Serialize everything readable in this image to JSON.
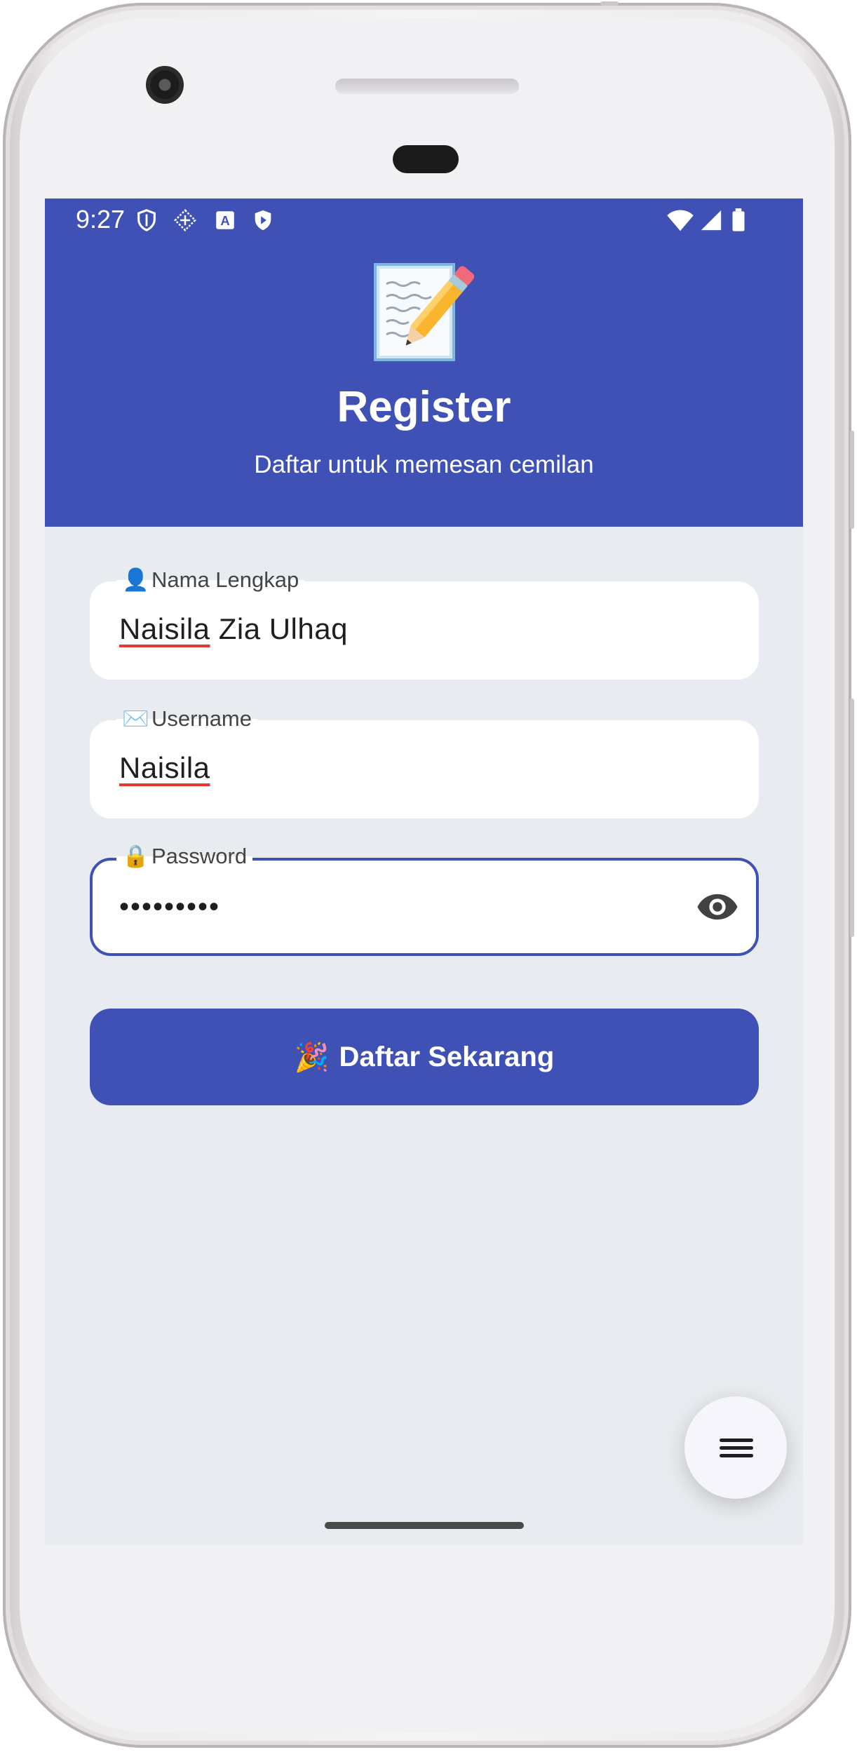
{
  "status_bar": {
    "time": "9:27",
    "left_icons": [
      "shield-outline-icon",
      "data-saver-icon",
      "translate-a-icon",
      "shield-play-icon"
    ],
    "right_icons": [
      "wifi-icon",
      "cell-signal-icon",
      "battery-icon"
    ]
  },
  "header": {
    "emoji": "memo-pencil",
    "title": "Register",
    "subtitle": "Daftar untuk memesan cemilan",
    "color": "#3f51b5"
  },
  "form": {
    "full_name": {
      "emoji": "👤",
      "label": "Nama Lengkap",
      "value_first": "Naisila",
      "value_rest": " Zia Ulhaq"
    },
    "username": {
      "emoji": "✉️",
      "label": "Username",
      "value": "Naisila"
    },
    "password": {
      "emoji": "🔒",
      "label": "Password",
      "value": "•••••••••",
      "toggle_icon": "eye-icon"
    }
  },
  "submit": {
    "emoji": "🎉",
    "label": "Daftar Sekarang"
  },
  "fab": {
    "icon": "menu-icon"
  }
}
